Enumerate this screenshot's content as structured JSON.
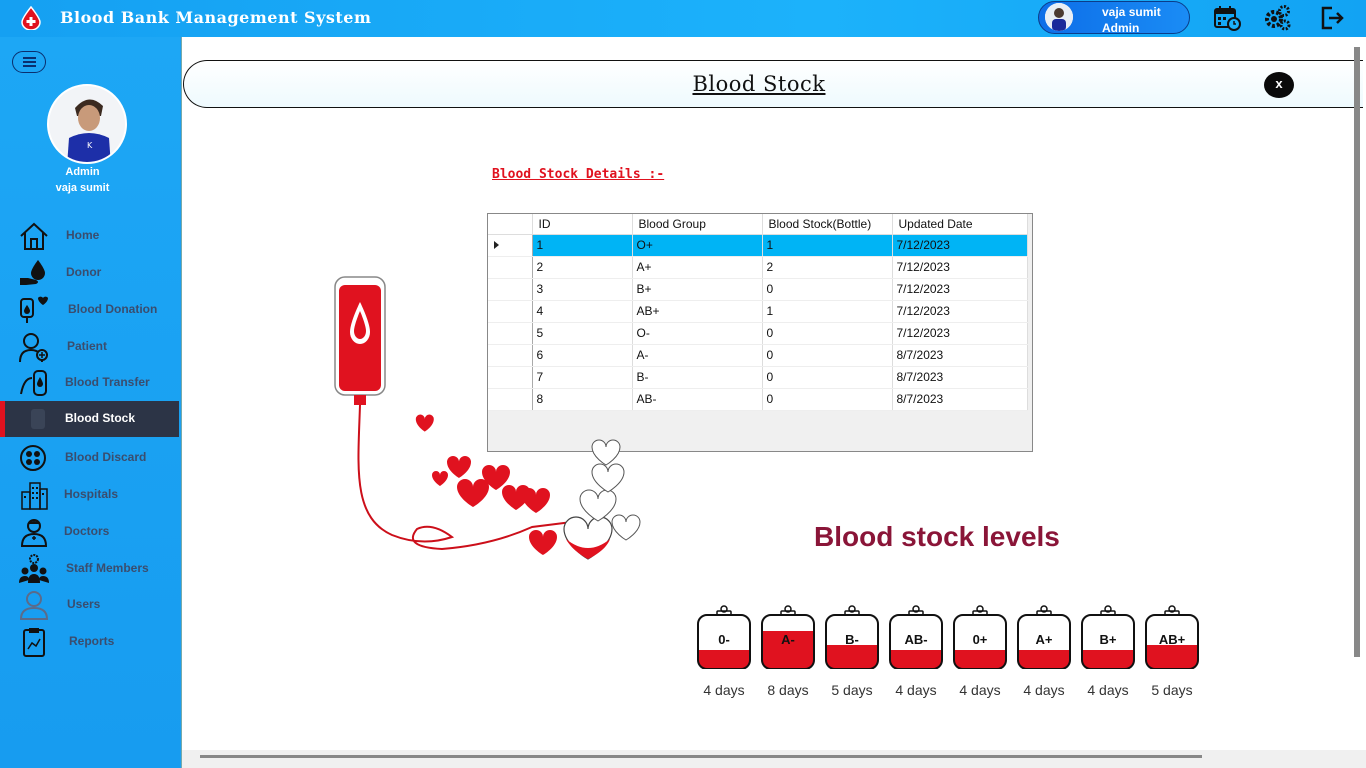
{
  "app": {
    "title": "Blood Bank Management System"
  },
  "user": {
    "name": "vaja sumit",
    "role": "Admin"
  },
  "sidebar": {
    "profile": {
      "role": "Admin",
      "name": "vaja sumit"
    },
    "items": [
      {
        "label": "Home",
        "icon": "home-icon"
      },
      {
        "label": "Donor",
        "icon": "donor-icon"
      },
      {
        "label": "Blood Donation",
        "icon": "blood-donation-icon"
      },
      {
        "label": "Patient",
        "icon": "patient-icon"
      },
      {
        "label": "Blood Transfer",
        "icon": "blood-transfer-icon"
      },
      {
        "label": "Blood Stock",
        "icon": "blood-stock-icon",
        "active": true
      },
      {
        "label": "Blood Discard",
        "icon": "blood-discard-icon"
      },
      {
        "label": "Hospitals",
        "icon": "hospital-icon"
      },
      {
        "label": "Doctors",
        "icon": "doctor-icon"
      },
      {
        "label": "Staff Members",
        "icon": "staff-icon"
      },
      {
        "label": "Users",
        "icon": "user-icon"
      },
      {
        "label": "Reports",
        "icon": "report-icon"
      }
    ]
  },
  "page": {
    "title": "Blood Stock",
    "close": "x",
    "section_label": "Blood Stock Details :-"
  },
  "grid": {
    "columns": [
      "ID",
      "Blood Group",
      "Blood Stock(Bottle)",
      "Updated Date"
    ],
    "rows": [
      [
        "1",
        "O+",
        "1",
        "7/12/2023"
      ],
      [
        "2",
        "A+",
        "2",
        "7/12/2023"
      ],
      [
        "3",
        "B+",
        "0",
        "7/12/2023"
      ],
      [
        "4",
        "AB+",
        "1",
        "7/12/2023"
      ],
      [
        "5",
        "O-",
        "0",
        "7/12/2023"
      ],
      [
        "6",
        "A-",
        "0",
        "8/7/2023"
      ],
      [
        "7",
        "B-",
        "0",
        "8/7/2023"
      ],
      [
        "8",
        "AB-",
        "0",
        "8/7/2023"
      ]
    ]
  },
  "levels": {
    "title": "Blood stock levels",
    "bags": [
      {
        "label": "0-",
        "days": "4 days",
        "fill": 0.35
      },
      {
        "label": "A-",
        "days": "8 days",
        "fill": 0.7
      },
      {
        "label": "B-",
        "days": "5 days",
        "fill": 0.45
      },
      {
        "label": "AB-",
        "days": "4 days",
        "fill": 0.35
      },
      {
        "label": "0+",
        "days": "4 days",
        "fill": 0.35
      },
      {
        "label": "A+",
        "days": "4 days",
        "fill": 0.35
      },
      {
        "label": "B+",
        "days": "4 days",
        "fill": 0.35
      },
      {
        "label": "AB+",
        "days": "5 days",
        "fill": 0.45
      }
    ]
  },
  "colors": {
    "accent": "#1da7f5",
    "blood": "#e0121f",
    "active_nav": "#2c3446",
    "selected_row": "#00b4f5"
  }
}
